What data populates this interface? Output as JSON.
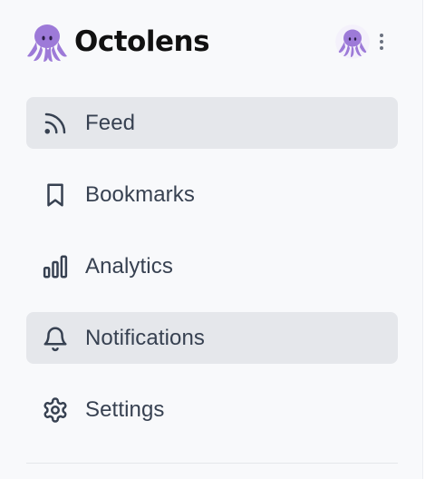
{
  "brand": {
    "name": "Octolens",
    "logo_icon": "octopus-logo-icon"
  },
  "header": {
    "avatar_icon": "octopus-avatar",
    "menu_icon": "vertical-dots-icon"
  },
  "nav": {
    "items": [
      {
        "label": "Feed",
        "icon": "rss-icon",
        "highlighted": true
      },
      {
        "label": "Bookmarks",
        "icon": "bookmark-icon",
        "highlighted": false
      },
      {
        "label": "Analytics",
        "icon": "bar-chart-icon",
        "highlighted": false
      },
      {
        "label": "Notifications",
        "icon": "bell-icon",
        "highlighted": true
      },
      {
        "label": "Settings",
        "icon": "gear-icon",
        "highlighted": false
      }
    ]
  },
  "colors": {
    "sidebar_bg": "#f8f9fb",
    "highlight_bg": "#e5e7eb",
    "text": "#374151",
    "brand_text": "#111111",
    "octopus": "#9d7ad8"
  }
}
